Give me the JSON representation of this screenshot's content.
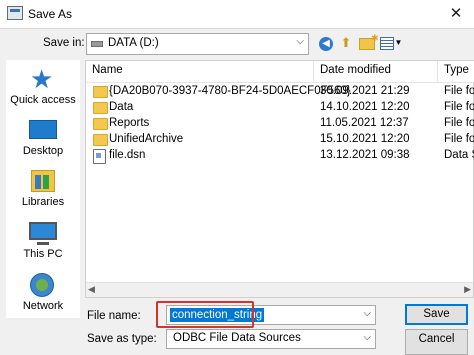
{
  "window": {
    "title": "Save As",
    "close_glyph": "✕"
  },
  "save_in": {
    "label": "Save in:",
    "value": "DATA (D:)",
    "icon": "drive-icon"
  },
  "toolbar": {
    "back_icon": "back-arrow-icon",
    "up_icon": "up-folder-icon",
    "new_folder_icon": "new-folder-icon",
    "view_icon": "view-menu-icon"
  },
  "places": [
    {
      "label": "Quick access",
      "icon": "star-icon"
    },
    {
      "label": "Desktop",
      "icon": "desktop-icon"
    },
    {
      "label": "Libraries",
      "icon": "libraries-icon"
    },
    {
      "label": "This PC",
      "icon": "computer-icon"
    },
    {
      "label": "Network",
      "icon": "network-icon"
    }
  ],
  "file_list": {
    "columns": [
      "Name",
      "Date modified",
      "Type"
    ],
    "rows": [
      {
        "name": "{DA20B070-3937-4780-BF24-5D0AECF0F560}",
        "date": "30.09.2021 21:29",
        "type": "File fo",
        "icon": "folder-icon"
      },
      {
        "name": "Data",
        "date": "14.10.2021 12:20",
        "type": "File fo",
        "icon": "folder-icon"
      },
      {
        "name": "Reports",
        "date": "11.05.2021 12:37",
        "type": "File fo",
        "icon": "folder-icon"
      },
      {
        "name": "UnifiedArchive",
        "date": "15.10.2021 12:20",
        "type": "File fo",
        "icon": "folder-icon"
      },
      {
        "name": "file.dsn",
        "date": "13.12.2021 09:38",
        "type": "Data S",
        "icon": "dsn-file-icon"
      }
    ]
  },
  "file_name": {
    "label": "File name:",
    "value": "connection_string"
  },
  "save_as_type": {
    "label": "Save as type:",
    "value": "ODBC File Data Sources"
  },
  "buttons": {
    "save": "Save",
    "cancel": "Cancel"
  },
  "colors": {
    "selection": "#0078d7",
    "highlight_box": "#d7332d",
    "dialog_bg": "#f0f0f0"
  }
}
